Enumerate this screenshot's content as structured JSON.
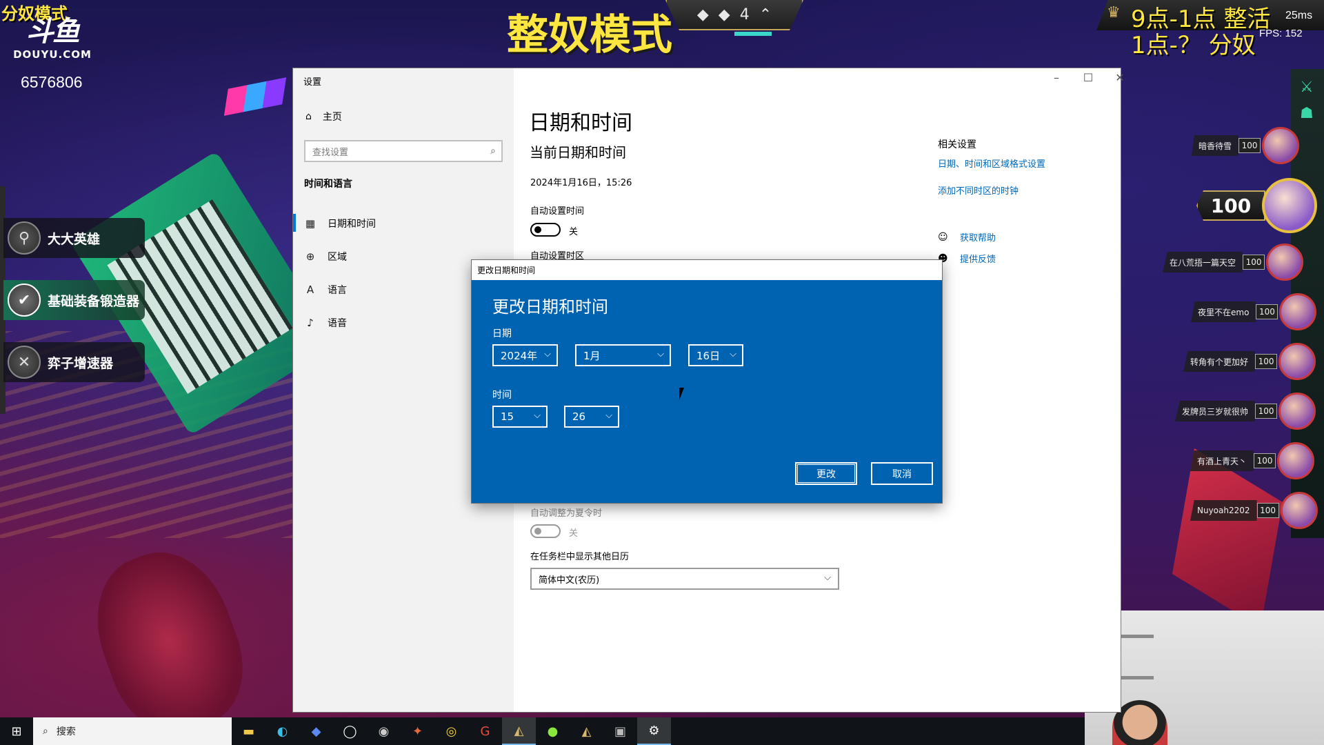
{
  "stream": {
    "mode_tag": "分奴模式",
    "logo_glyph": "斗鱼",
    "logo_site": "DOUYU.COM",
    "room_id": "6576806",
    "top_title": "整奴模式",
    "hud_count": "4",
    "overlay_line1": "9点-1点 整活",
    "overlay_line2": "1点-？  分奴",
    "ping": "25ms",
    "fps": "FPS:  152"
  },
  "game_left_panels": [
    {
      "label": "大大英雄",
      "icon": "pin-icon"
    },
    {
      "label": "基础装备锻造器",
      "icon": "check-icon"
    },
    {
      "label": "弈子增速器",
      "icon": "wrench-icon"
    }
  ],
  "players": [
    {
      "name": "暗香待雪",
      "hp": "100"
    },
    {
      "name": "在八荒捂一篇天空",
      "hp": "100"
    },
    {
      "name": "夜里不在emo",
      "hp": "100"
    },
    {
      "name": "转角有个更加好",
      "hp": "100"
    },
    {
      "name": "发牌员三岁就很帅",
      "hp": "100"
    },
    {
      "name": "有酒上青天丶",
      "hp": "100"
    },
    {
      "name": "Nuyoah2202",
      "hp": "100"
    }
  ],
  "big_player_hp": "100",
  "settings": {
    "window_title": "设置",
    "nav_home": "主页",
    "search_placeholder": "查找设置",
    "section": "时间和语言",
    "nav_items": [
      {
        "label": "日期和时间",
        "icon": "calendar-icon"
      },
      {
        "label": "区域",
        "icon": "globe-icon"
      },
      {
        "label": "语言",
        "icon": "language-icon"
      },
      {
        "label": "语音",
        "icon": "microphone-icon"
      }
    ],
    "page_title": "日期和时间",
    "current_heading": "当前日期和时间",
    "current_value": "2024年1月16日，15:26",
    "auto_time_label": "自动设置时间",
    "auto_time_state": "关",
    "auto_zone_label": "自动设置时区",
    "dst_label": "自动调整为夏令时",
    "dst_state": "关",
    "calendar_label": "在任务栏中显示其他日历",
    "calendar_value": "简体中文(农历)",
    "related_title": "相关设置",
    "related_links": [
      "日期、时间和区域格式设置",
      "添加不同时区的时钟"
    ],
    "help_link": "获取帮助",
    "feedback_link": "提供反馈"
  },
  "dialog": {
    "titlebar": "更改日期和时间",
    "heading": "更改日期和时间",
    "date_label": "日期",
    "year": "2024年",
    "month": "1月",
    "day": "16日",
    "time_label": "时间",
    "hour": "15",
    "minute": "26",
    "change_button": "更改",
    "cancel_button": "取消"
  },
  "taskbar": {
    "search_label": "搜索",
    "apps": [
      "file-explorer-icon",
      "edge-icon",
      "app-icon",
      "app-icon",
      "obs-icon",
      "app-icon",
      "app-icon",
      "app-icon",
      "lol-icon",
      "app-icon",
      "lol-icon",
      "app-icon",
      "settings-gear-icon"
    ]
  }
}
